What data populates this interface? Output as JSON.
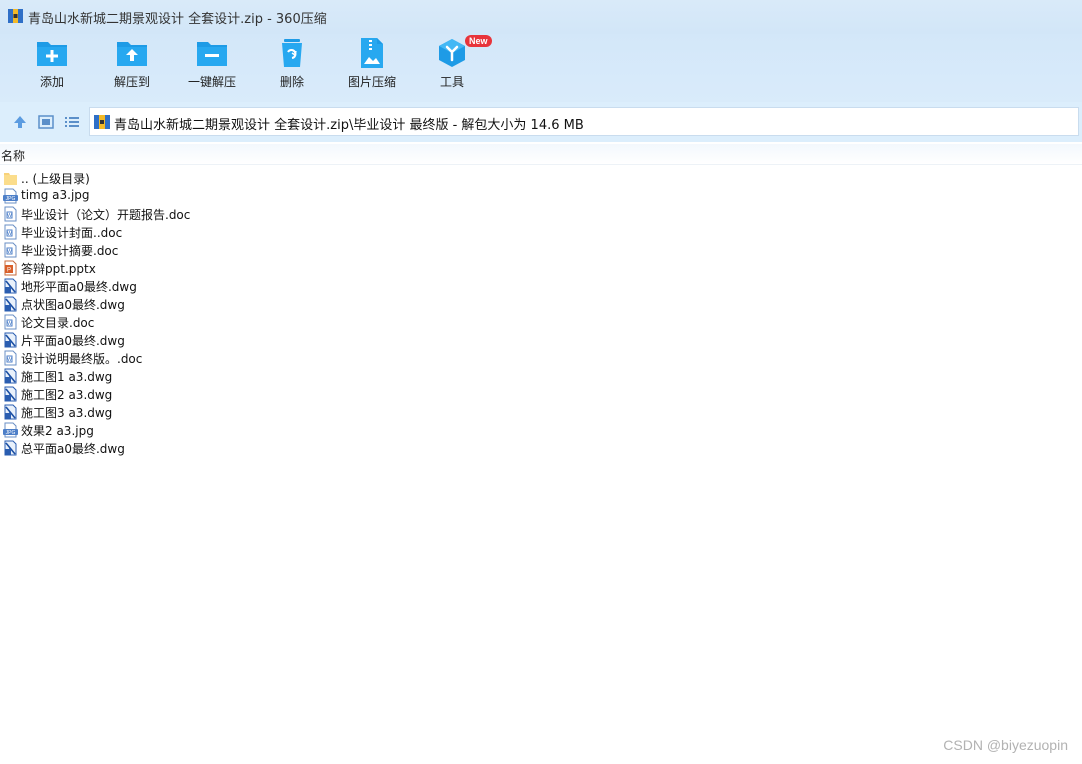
{
  "window": {
    "title": "青岛山水新城二期景观设计 全套设计.zip - 360压缩"
  },
  "toolbar": {
    "add": "添加",
    "extract_to": "解压到",
    "one_click_extract": "一键解压",
    "delete": "删除",
    "image_compress": "图片压缩",
    "tools": "工具",
    "new_badge": "New"
  },
  "navbar": {
    "path": "青岛山水新城二期景观设计 全套设计.zip\\毕业设计  最终版 - 解包大小为 14.6 MB"
  },
  "list": {
    "column_name": "名称",
    "rows": [
      {
        "name": ".. (上级目录)",
        "icon": "folder-icon"
      },
      {
        "name": "timg  a3.jpg",
        "icon": "jpg-icon"
      },
      {
        "name": "毕业设计（论文）开题报告.doc",
        "icon": "doc-icon"
      },
      {
        "name": "毕业设计封面..doc",
        "icon": "doc-icon"
      },
      {
        "name": "毕业设计摘要.doc",
        "icon": "doc-icon"
      },
      {
        "name": "答辩ppt.pptx",
        "icon": "pptx-icon"
      },
      {
        "name": "地形平面a0最终.dwg",
        "icon": "dwg-icon"
      },
      {
        "name": "点状图a0最终.dwg",
        "icon": "dwg-icon"
      },
      {
        "name": "论文目录.doc",
        "icon": "doc-icon"
      },
      {
        "name": "片平面a0最终.dwg",
        "icon": "dwg-icon"
      },
      {
        "name": "设计说明最终版。.doc",
        "icon": "doc-icon"
      },
      {
        "name": "施工图1 a3.dwg",
        "icon": "dwg-icon"
      },
      {
        "name": "施工图2 a3.dwg",
        "icon": "dwg-icon"
      },
      {
        "name": "施工图3 a3.dwg",
        "icon": "dwg-icon"
      },
      {
        "name": "效果2 a3.jpg",
        "icon": "jpg-icon"
      },
      {
        "name": "总平面a0最终.dwg",
        "icon": "dwg-icon"
      }
    ]
  },
  "watermark": "CSDN @biyezuopin",
  "colors": {
    "accent": "#1e9be6",
    "toolbar_bg": "#d3e7f9",
    "new_badge": "#e8343b"
  }
}
